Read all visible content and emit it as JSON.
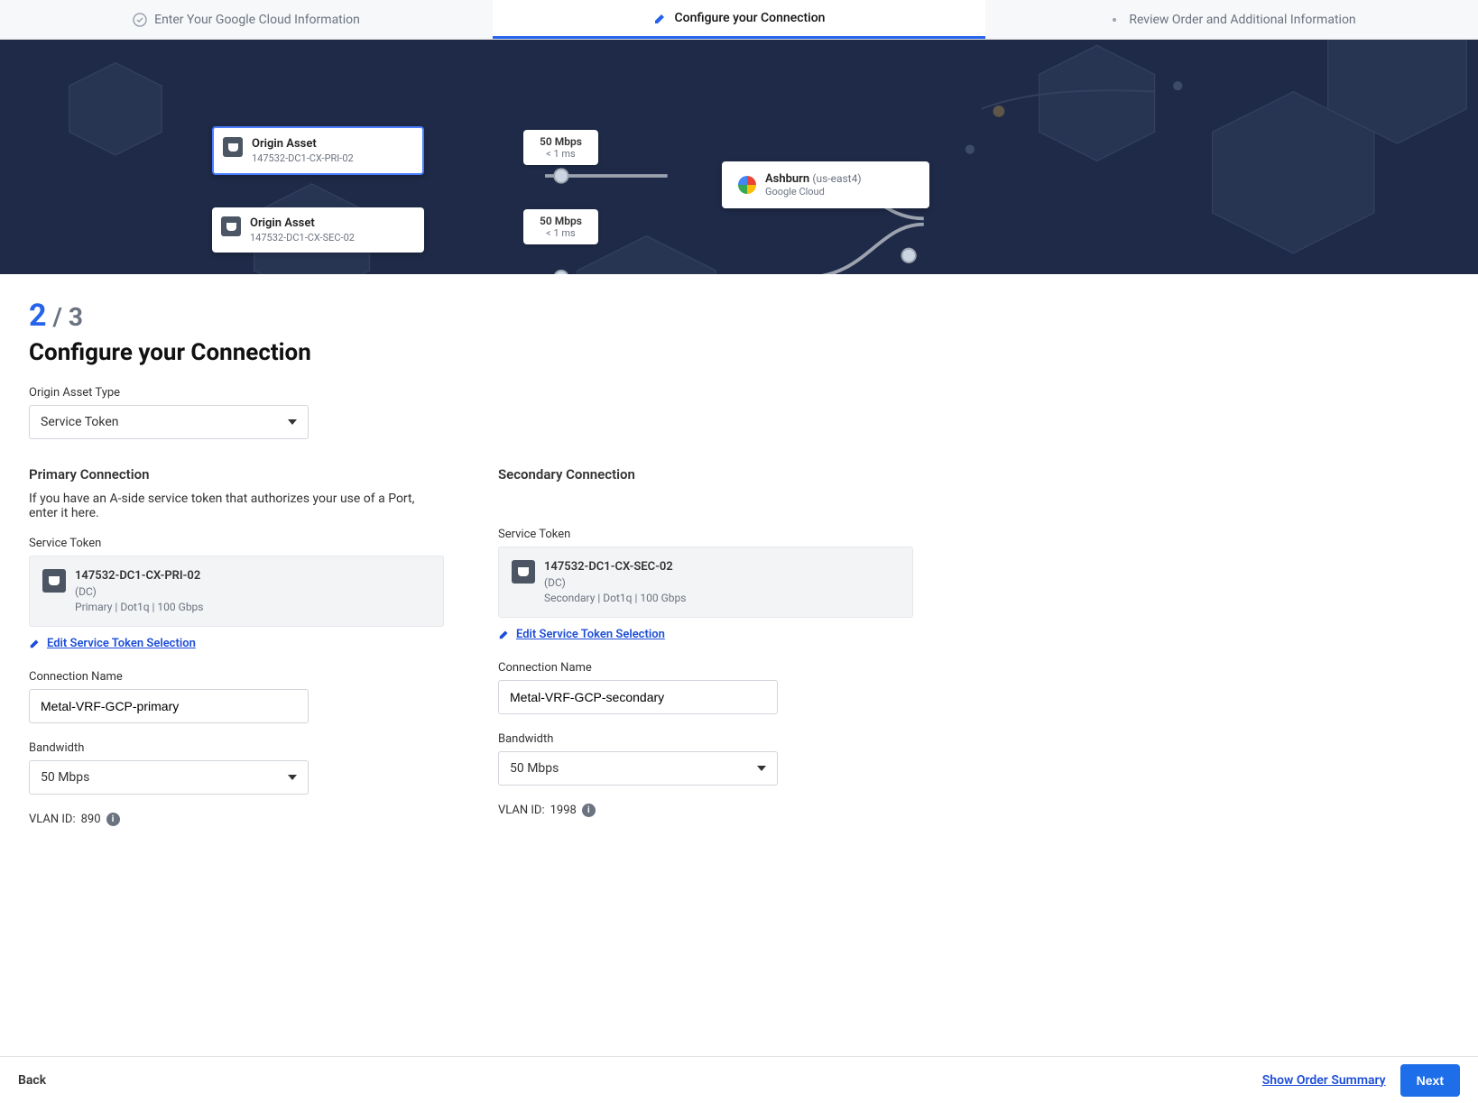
{
  "stepper": {
    "step1": "Enter Your Google Cloud Information",
    "step2": "Configure your Connection",
    "step3": "Review Order and Additional Information"
  },
  "diagram": {
    "origin_title": "Origin Asset",
    "origin_primary_id": "147532-DC1-CX-PRI-02",
    "origin_secondary_id": "147532-DC1-CX-SEC-02",
    "speed": "50 Mbps",
    "latency": "< 1 ms",
    "dest_city": "Ashburn",
    "dest_region": "(us-east4)",
    "dest_provider": "Google Cloud"
  },
  "counter": {
    "current": "2",
    "total": "/ 3"
  },
  "page_title": "Configure your Connection",
  "origin_type_label": "Origin Asset Type",
  "origin_type_value": "Service Token",
  "primary": {
    "title": "Primary Connection",
    "hint": "If you have an A-side service token that authorizes your use of a Port, enter it here.",
    "token_label": "Service Token",
    "token_name": "147532-DC1-CX-PRI-02",
    "token_loc": "(DC)",
    "token_meta": "Primary | Dot1q | 100 Gbps",
    "edit_link": "Edit Service Token Selection",
    "conn_label": "Connection Name",
    "conn_value": "Metal-VRF-GCP-primary",
    "bw_label": "Bandwidth",
    "bw_value": "50 Mbps",
    "vlan_label": "VLAN ID:",
    "vlan_value": "890"
  },
  "secondary": {
    "title": "Secondary Connection",
    "token_label": "Service Token",
    "token_name": "147532-DC1-CX-SEC-02",
    "token_loc": "(DC)",
    "token_meta": "Secondary | Dot1q | 100 Gbps",
    "edit_link": "Edit Service Token Selection",
    "conn_label": "Connection Name",
    "conn_value": "Metal-VRF-GCP-secondary",
    "bw_label": "Bandwidth",
    "bw_value": "50 Mbps",
    "vlan_label": "VLAN ID:",
    "vlan_value": "1998"
  },
  "footer": {
    "back": "Back",
    "summary": "Show Order Summary",
    "next": "Next"
  }
}
